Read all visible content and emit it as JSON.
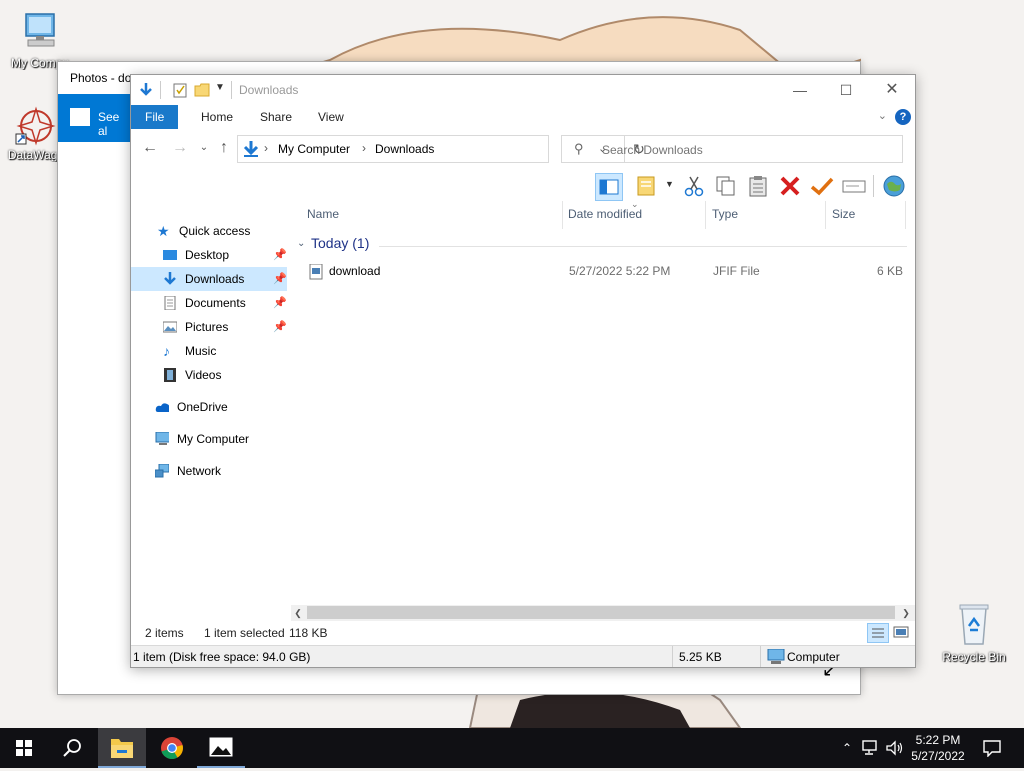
{
  "desktop": {
    "icons": [
      {
        "label": "My Compu"
      },
      {
        "label": "DataWago"
      },
      {
        "label": "Recycle Bin"
      }
    ]
  },
  "photos": {
    "title": "Photos - do",
    "see_all_label": "See al"
  },
  "explorer": {
    "title": "Downloads",
    "ribbon_tabs": [
      "File",
      "Home",
      "Share",
      "View"
    ],
    "address": {
      "root": "My Computer",
      "current": "Downloads"
    },
    "search": {
      "placeholder": "Search Downloads"
    },
    "nav": {
      "quick_access": "Quick access",
      "items": [
        {
          "label": "Desktop",
          "pinned": true
        },
        {
          "label": "Downloads",
          "pinned": true,
          "selected": true
        },
        {
          "label": "Documents",
          "pinned": true
        },
        {
          "label": "Pictures",
          "pinned": true
        },
        {
          "label": "Music",
          "pinned": false
        },
        {
          "label": "Videos",
          "pinned": false
        }
      ],
      "onedrive": "OneDrive",
      "my_computer": "My Computer",
      "network": "Network"
    },
    "columns": {
      "name": "Name",
      "date": "Date modified",
      "type": "Type",
      "size": "Size"
    },
    "group": "Today (1)",
    "files": [
      {
        "name": "download",
        "date": "5/27/2022 5:22 PM",
        "type": "JFIF File",
        "size": "6 KB"
      }
    ],
    "status": {
      "items": "2 items",
      "selected": "1 item selected",
      "selected_size": "118 KB",
      "disk": "1 item (Disk free space: 94.0 GB)",
      "size": "5.25 KB",
      "location": "Computer"
    }
  },
  "taskbar": {
    "time": "5:22 PM",
    "date": "5/27/2022"
  },
  "colors": {
    "accent": "#1979ca",
    "selection": "#cce8ff",
    "taskbar": "#101014"
  }
}
